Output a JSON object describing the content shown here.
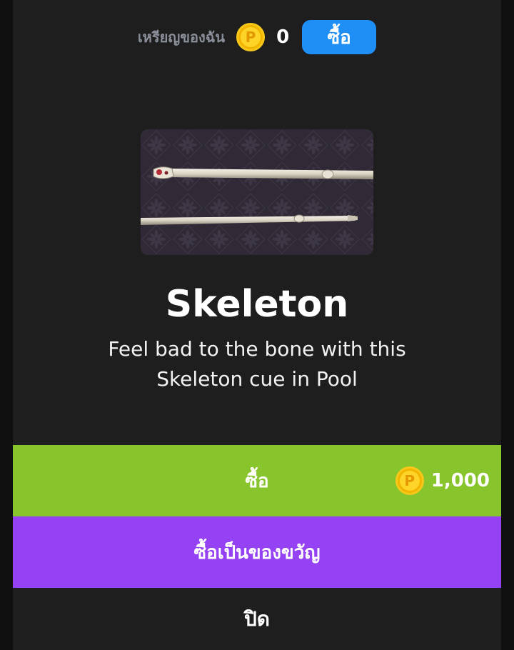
{
  "header": {
    "coin_label": "เหรียญของฉัน",
    "coin_icon": "coin-p-icon",
    "coin_count": "0",
    "buy_label": "ซื้อ"
  },
  "product": {
    "image_name": "skeleton-cue-image",
    "title": "Skeleton",
    "description": "Feel bad to the bone with this Skeleton cue in Pool"
  },
  "actions": {
    "buy_label": "ซื้อ",
    "price": "1,000",
    "gift_label": "ซื้อเป็นของขวัญ",
    "close_label": "ปิด"
  },
  "colors": {
    "buy_small": "#1f8ff5",
    "buy_button": "#88c42c",
    "gift_button": "#9442f3",
    "coin": "#f1b400"
  }
}
